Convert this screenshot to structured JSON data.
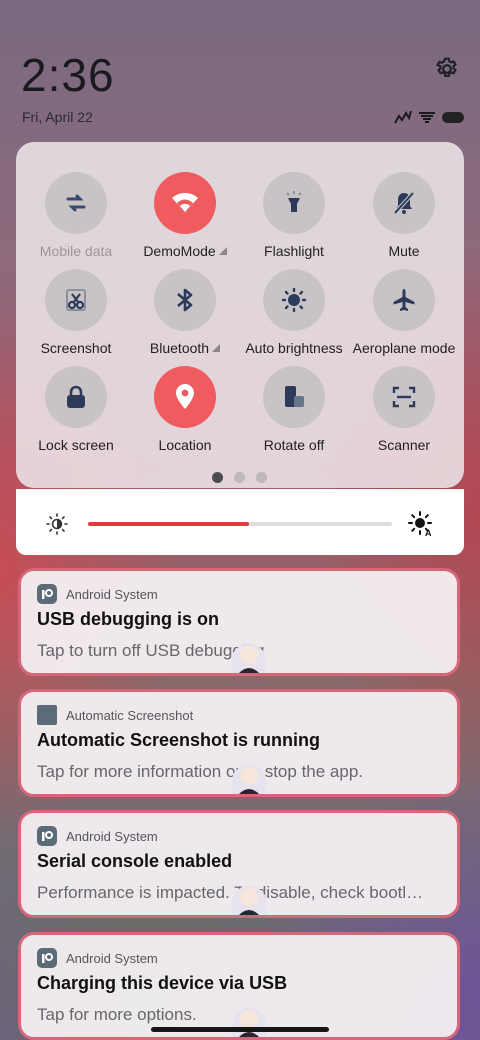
{
  "status_bar": {
    "time": "2:36",
    "date": "Fri, April 22",
    "icons": [
      "signal-icon",
      "wifi-icon",
      "battery-icon"
    ]
  },
  "quick_settings": {
    "tiles": [
      {
        "label": "Mobile data",
        "icon": "mobile-data-icon",
        "active": false,
        "disabled": true
      },
      {
        "label": "DemoMode",
        "icon": "wifi-icon",
        "active": true,
        "has_menu": true
      },
      {
        "label": "Flashlight",
        "icon": "flashlight-icon",
        "active": false
      },
      {
        "label": "Mute",
        "icon": "bell-off-icon",
        "active": false
      },
      {
        "label": "Screenshot",
        "icon": "scissors-icon",
        "active": false
      },
      {
        "label": "Bluetooth",
        "icon": "bluetooth-icon",
        "active": false,
        "has_menu": true
      },
      {
        "label": "Auto brightness",
        "icon": "brightness-icon",
        "active": false
      },
      {
        "label": "Aeroplane mode",
        "icon": "airplane-icon",
        "active": false
      },
      {
        "label": "Lock screen",
        "icon": "lock-icon",
        "active": false
      },
      {
        "label": "Location",
        "icon": "location-icon",
        "active": true
      },
      {
        "label": "Rotate off",
        "icon": "rotate-icon",
        "active": false
      },
      {
        "label": "Scanner",
        "icon": "scanner-icon",
        "active": false
      }
    ],
    "page_count": 3,
    "current_page": 1,
    "active_color": "#f05b60"
  },
  "brightness": {
    "level_fraction": 0.53,
    "accent": "#e8383f"
  },
  "notifications": [
    {
      "app": "Android System",
      "title": "USB debugging is on",
      "body": "Tap to turn off USB debugging",
      "icon": "android-system-icon"
    },
    {
      "app": "Automatic Screenshot",
      "title": "Automatic Screenshot is running",
      "body": "Tap for more information or to stop the app.",
      "icon": "app-square-icon"
    },
    {
      "app": "Android System",
      "title": "Serial console enabled",
      "body": "Performance is impacted. To disable, check bootl…",
      "icon": "android-system-icon"
    },
    {
      "app": "Android System",
      "title": "Charging this device via USB",
      "body": "Tap for more options.",
      "icon": "android-system-icon"
    }
  ]
}
